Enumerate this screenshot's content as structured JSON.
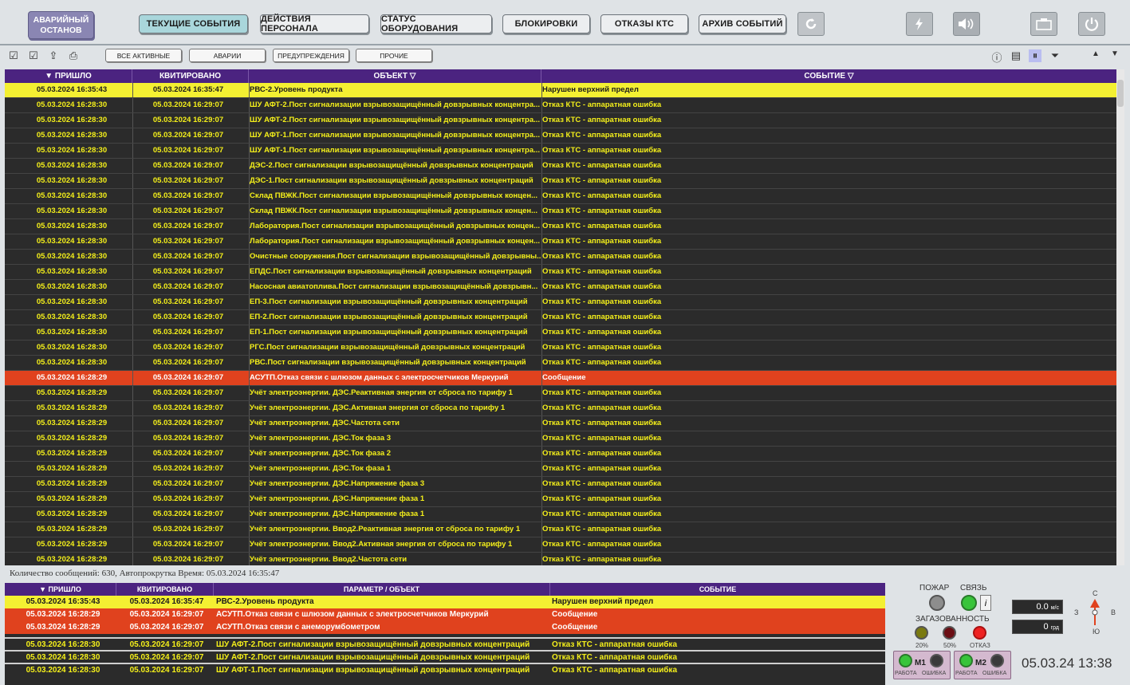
{
  "toolbar": {
    "emergency_line1": "АВАРИЙНЫЙ",
    "emergency_line2": "ОСТАНОВ",
    "tabs": [
      "ТЕКУЩИЕ СОБЫТИЯ",
      "ДЕЙСТВИЯ ПЕРСОНАЛА",
      "СТАТУС ОБОРУДОВАНИЯ",
      "БЛОКИРОВКИ",
      "ОТКАЗЫ КТС",
      "АРХИВ СОБЫТИЙ"
    ],
    "active_tab": "ТЕКУЩИЕ СОБЫТИЯ"
  },
  "filters": [
    "ВСЕ АКТИВНЫЕ",
    "АВАРИИ",
    "ПРЕДУПРЕЖДЕНИЯ",
    "ПРОЧИЕ"
  ],
  "main_table": {
    "headers": [
      "▼ ПРИШЛО",
      "КВИТИРОВАНО",
      "ОБЪЕКТ ▽",
      "СОБЫТИЕ ▽"
    ],
    "rows": [
      {
        "came": "05.03.2024 16:35:43",
        "ack": "05.03.2024 16:35:47",
        "object": "РВС-2.Уровень продукта",
        "event": "Нарушен верхний предел",
        "style": "yel"
      },
      {
        "came": "05.03.2024 16:28:30",
        "ack": "05.03.2024 16:29:07",
        "object": "ШУ АФТ-2.Пост сигнализации взрывозащищённый довзрывных концентра...",
        "event": "Отказ КТС - аппаратная ошибка",
        "style": "dark"
      },
      {
        "came": "05.03.2024 16:28:30",
        "ack": "05.03.2024 16:29:07",
        "object": "ШУ АФТ-2.Пост сигнализации взрывозащищённый довзрывных концентра...",
        "event": "Отказ КТС - аппаратная ошибка",
        "style": "dark"
      },
      {
        "came": "05.03.2024 16:28:30",
        "ack": "05.03.2024 16:29:07",
        "object": "ШУ АФТ-1.Пост сигнализации взрывозащищённый довзрывных концентра...",
        "event": "Отказ КТС - аппаратная ошибка",
        "style": "dark"
      },
      {
        "came": "05.03.2024 16:28:30",
        "ack": "05.03.2024 16:29:07",
        "object": "ШУ АФТ-1.Пост сигнализации взрывозащищённый довзрывных концентра...",
        "event": "Отказ КТС - аппаратная ошибка",
        "style": "dark"
      },
      {
        "came": "05.03.2024 16:28:30",
        "ack": "05.03.2024 16:29:07",
        "object": "ДЭС-2.Пост сигнализации взрывозащищённый довзрывных концентраций",
        "event": "Отказ КТС - аппаратная ошибка",
        "style": "dark"
      },
      {
        "came": "05.03.2024 16:28:30",
        "ack": "05.03.2024 16:29:07",
        "object": "ДЭС-1.Пост сигнализации взрывозащищённый довзрывных концентраций",
        "event": "Отказ КТС - аппаратная ошибка",
        "style": "dark"
      },
      {
        "came": "05.03.2024 16:28:30",
        "ack": "05.03.2024 16:29:07",
        "object": "Склад ПВЖК.Пост сигнализации взрывозащищённый довзрывных концен...",
        "event": "Отказ КТС - аппаратная ошибка",
        "style": "dark"
      },
      {
        "came": "05.03.2024 16:28:30",
        "ack": "05.03.2024 16:29:07",
        "object": "Склад ПВЖК.Пост сигнализации взрывозащищённый довзрывных концен...",
        "event": "Отказ КТС - аппаратная ошибка",
        "style": "dark"
      },
      {
        "came": "05.03.2024 16:28:30",
        "ack": "05.03.2024 16:29:07",
        "object": "Лаборатория.Пост сигнализации взрывозащищённый довзрывных концен...",
        "event": "Отказ КТС - аппаратная ошибка",
        "style": "dark"
      },
      {
        "came": "05.03.2024 16:28:30",
        "ack": "05.03.2024 16:29:07",
        "object": "Лаборатория.Пост сигнализации взрывозащищённый довзрывных концен...",
        "event": "Отказ КТС - аппаратная ошибка",
        "style": "dark"
      },
      {
        "came": "05.03.2024 16:28:30",
        "ack": "05.03.2024 16:29:07",
        "object": "Очистные сооружения.Пост сигнализации взрывозащищённый довзрывны...",
        "event": "Отказ КТС - аппаратная ошибка",
        "style": "dark"
      },
      {
        "came": "05.03.2024 16:28:30",
        "ack": "05.03.2024 16:29:07",
        "object": "ЕПДС.Пост сигнализации взрывозащищённый довзрывных концентраций",
        "event": "Отказ КТС - аппаратная ошибка",
        "style": "dark"
      },
      {
        "came": "05.03.2024 16:28:30",
        "ack": "05.03.2024 16:29:07",
        "object": "Насосная авиатоплива.Пост сигнализации взрывозащищённый довзрывн...",
        "event": "Отказ КТС - аппаратная ошибка",
        "style": "dark"
      },
      {
        "came": "05.03.2024 16:28:30",
        "ack": "05.03.2024 16:29:07",
        "object": "ЕП-3.Пост сигнализации взрывозащищённый довзрывных концентраций",
        "event": "Отказ КТС - аппаратная ошибка",
        "style": "dark"
      },
      {
        "came": "05.03.2024 16:28:30",
        "ack": "05.03.2024 16:29:07",
        "object": "ЕП-2.Пост сигнализации взрывозащищённый довзрывных концентраций",
        "event": "Отказ КТС - аппаратная ошибка",
        "style": "dark"
      },
      {
        "came": "05.03.2024 16:28:30",
        "ack": "05.03.2024 16:29:07",
        "object": "ЕП-1.Пост сигнализации взрывозащищённый довзрывных концентраций",
        "event": "Отказ КТС - аппаратная ошибка",
        "style": "dark"
      },
      {
        "came": "05.03.2024 16:28:30",
        "ack": "05.03.2024 16:29:07",
        "object": "РГС.Пост сигнализации взрывозащищённый довзрывных концентраций",
        "event": "Отказ КТС - аппаратная ошибка",
        "style": "dark"
      },
      {
        "came": "05.03.2024 16:28:30",
        "ack": "05.03.2024 16:29:07",
        "object": "РВС.Пост сигнализации взрывозащищённый довзрывных концентраций",
        "event": "Отказ КТС - аппаратная ошибка",
        "style": "dark"
      },
      {
        "came": "05.03.2024 16:28:29",
        "ack": "05.03.2024 16:29:07",
        "object": "АСУТП.Отказ связи с шлюзом данных с электросчетчиков Меркурий",
        "event": "Сообщение",
        "style": "red"
      },
      {
        "came": "05.03.2024 16:28:29",
        "ack": "05.03.2024 16:29:07",
        "object": "Учёт электроэнергии. ДЭС.Реактивная энергия от сброса по тарифу 1",
        "event": "Отказ КТС - аппаратная ошибка",
        "style": "dark"
      },
      {
        "came": "05.03.2024 16:28:29",
        "ack": "05.03.2024 16:29:07",
        "object": "Учёт электроэнергии. ДЭС.Активная энергия от сброса по тарифу 1",
        "event": "Отказ КТС - аппаратная ошибка",
        "style": "dark"
      },
      {
        "came": "05.03.2024 16:28:29",
        "ack": "05.03.2024 16:29:07",
        "object": "Учёт электроэнергии. ДЭС.Частота сети",
        "event": "Отказ КТС - аппаратная ошибка",
        "style": "dark"
      },
      {
        "came": "05.03.2024 16:28:29",
        "ack": "05.03.2024 16:29:07",
        "object": "Учёт электроэнергии. ДЭС.Ток фаза 3",
        "event": "Отказ КТС - аппаратная ошибка",
        "style": "dark"
      },
      {
        "came": "05.03.2024 16:28:29",
        "ack": "05.03.2024 16:29:07",
        "object": "Учёт электроэнергии. ДЭС.Ток фаза 2",
        "event": "Отказ КТС - аппаратная ошибка",
        "style": "dark"
      },
      {
        "came": "05.03.2024 16:28:29",
        "ack": "05.03.2024 16:29:07",
        "object": "Учёт электроэнергии. ДЭС.Ток фаза 1",
        "event": "Отказ КТС - аппаратная ошибка",
        "style": "dark"
      },
      {
        "came": "05.03.2024 16:28:29",
        "ack": "05.03.2024 16:29:07",
        "object": "Учёт электроэнергии. ДЭС.Напряжение фаза 3",
        "event": "Отказ КТС - аппаратная ошибка",
        "style": "dark"
      },
      {
        "came": "05.03.2024 16:28:29",
        "ack": "05.03.2024 16:29:07",
        "object": "Учёт электроэнергии. ДЭС.Напряжение фаза 1",
        "event": "Отказ КТС - аппаратная ошибка",
        "style": "dark"
      },
      {
        "came": "05.03.2024 16:28:29",
        "ack": "05.03.2024 16:29:07",
        "object": "Учёт электроэнергии. ДЭС.Напряжение фаза 1",
        "event": "Отказ КТС - аппаратная ошибка",
        "style": "dark"
      },
      {
        "came": "05.03.2024 16:28:29",
        "ack": "05.03.2024 16:29:07",
        "object": "Учёт электроэнергии. Ввод2.Реактивная энергия от сброса по тарифу 1",
        "event": "Отказ КТС - аппаратная ошибка",
        "style": "dark"
      },
      {
        "came": "05.03.2024 16:28:29",
        "ack": "05.03.2024 16:29:07",
        "object": "Учёт электроэнергии. Ввод2.Активная энергия от сброса по тарифу 1",
        "event": "Отказ КТС - аппаратная ошибка",
        "style": "dark"
      },
      {
        "came": "05.03.2024 16:28:29",
        "ack": "05.03.2024 16:29:07",
        "object": "Учёт электроэнергии. Ввод2.Частота сети",
        "event": "Отказ КТС - аппаратная ошибка",
        "style": "dark"
      }
    ]
  },
  "status_line": "Количество сообщений: 630, Автопрокрутка Время: 05.03.2024 16:35:47",
  "bottom_table": {
    "headers": [
      "▼ ПРИШЛО",
      "КВИТИРОВАНО",
      "ПАРАМЕТР / ОБЪЕКТ",
      "СОБЫТИЕ"
    ],
    "rows": [
      {
        "came": "05.03.2024 16:35:43",
        "ack": "05.03.2024 16:35:47",
        "object": "РВС-2.Уровень продукта",
        "event": "Нарушен верхний предел",
        "style": "yel"
      },
      {
        "came": "05.03.2024 16:28:29",
        "ack": "05.03.2024 16:29:07",
        "object": "АСУТП.Отказ связи с шлюзом данных с электросчетчиков Меркурий",
        "event": "Сообщение",
        "style": "red"
      },
      {
        "came": "05.03.2024 16:28:29",
        "ack": "05.03.2024 16:29:07",
        "object": "АСУТП.Отказ связи с анеморумбометром",
        "event": "Сообщение",
        "style": "red"
      },
      {
        "came": "05.03.2024 16:28:30",
        "ack": "05.03.2024 16:29:07",
        "object": "ШУ АФТ-2.Пост сигнализации взрывозащищённый довзрывных концентраций",
        "event": "Отказ КТС - аппаратная ошибка",
        "style": "dark"
      },
      {
        "came": "05.03.2024 16:28:30",
        "ack": "05.03.2024 16:29:07",
        "object": "ШУ АФТ-2.Пост сигнализации взрывозащищённый довзрывных концентраций",
        "event": "Отказ КТС - аппаратная ошибка",
        "style": "dark"
      },
      {
        "came": "05.03.2024 16:28:30",
        "ack": "05.03.2024 16:29:07",
        "object": "ШУ АФТ-1.Пост сигнализации взрывозащищённый довзрывных концентраций",
        "event": "Отказ КТС - аппаратная ошибка",
        "style": "dark"
      }
    ]
  },
  "panel": {
    "fire_label": "ПОЖАР",
    "link_label": "СВЯЗЬ",
    "gas_label": "ЗАГАЗОВАННОСТЬ",
    "gas_20": "20%",
    "gas_50": "50%",
    "gas_fail": "ОТКАЗ",
    "wind_speed": "0.0",
    "wind_speed_unit": "м/с",
    "wind_dir": "0",
    "wind_dir_unit": "грд",
    "north": "С",
    "south": "Ю",
    "west": "З",
    "east": "В",
    "m1_label": "М1",
    "m2_label": "М2",
    "work_label": "РАБОТА",
    "error_label": "ОШИБКА",
    "clock": "05.03.24 13:38",
    "info_mark": "i"
  },
  "colors": {
    "header": "#4b2380",
    "row_dark": "#2b2b2b",
    "row_text": "#f5f01a",
    "alarm_yellow": "#f4f032",
    "alarm_red": "#e0421e"
  },
  "icons": [
    "refresh-icon",
    "lightning-icon",
    "sound-icon",
    "camera-icon",
    "power-icon"
  ]
}
